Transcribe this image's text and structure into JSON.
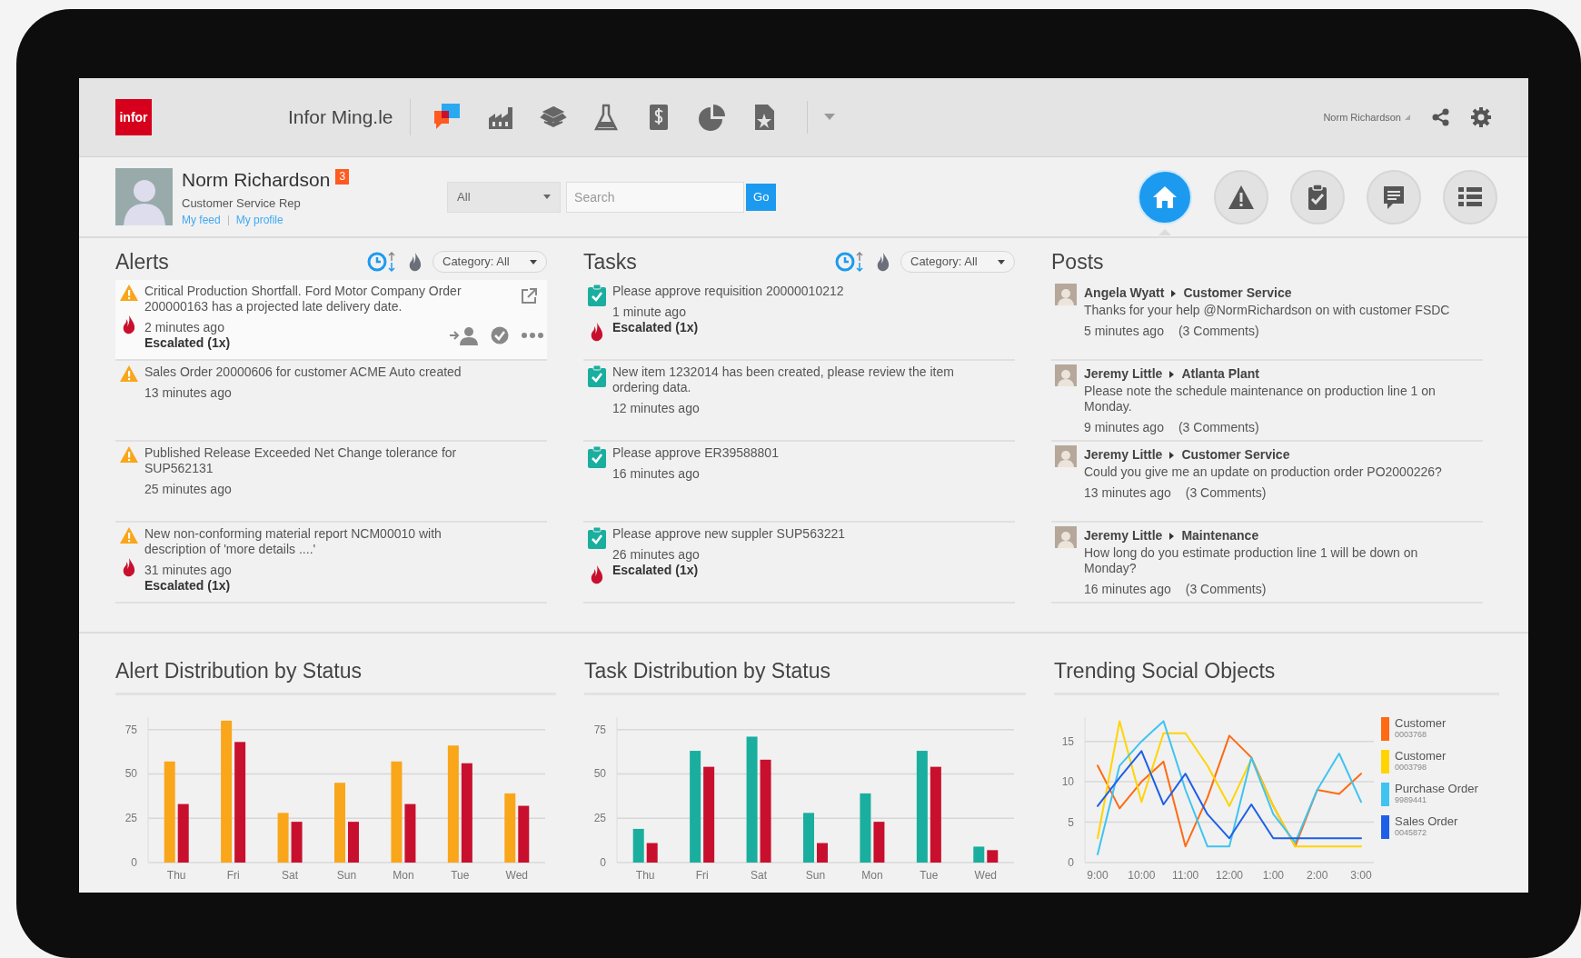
{
  "header": {
    "logo": "infor",
    "app_title": "Infor Ming.le",
    "user_menu": "Norm Richardson"
  },
  "profile": {
    "name": "Norm Richardson",
    "badge": "3",
    "role": "Customer Service Rep",
    "links": [
      "My feed",
      "My profile"
    ]
  },
  "search": {
    "scope": "All",
    "placeholder": "Search",
    "button": "Go"
  },
  "nav_buttons": [
    {
      "kind": "home",
      "selected": true
    },
    {
      "kind": "alerts",
      "selected": false
    },
    {
      "kind": "tasks",
      "selected": false
    },
    {
      "kind": "posts",
      "selected": false
    },
    {
      "kind": "list",
      "selected": false
    }
  ],
  "alerts": {
    "title": "Alerts",
    "filter": "Category: All",
    "items": [
      {
        "text": "Critical Production Shortfall. Ford Motor Company Order 200000163 has a projected late delivery date.",
        "time": "2 minutes ago",
        "escalation": "Escalated (1x)",
        "selected": true
      },
      {
        "text": "Sales Order 20000606 for customer ACME Auto created",
        "time": "13 minutes ago",
        "selected": false
      },
      {
        "text": "Published Release Exceeded Net Change tolerance for SUP562131",
        "time": "25 minutes ago",
        "selected": false
      },
      {
        "text": "New non-conforming material report NCM00010 with description of 'more details ....'",
        "time": "31 minutes ago",
        "escalation": "Escalated (1x)",
        "selected": false
      }
    ]
  },
  "tasks": {
    "title": "Tasks",
    "filter": "Category: All",
    "items": [
      {
        "text": "Please approve requisition 20000010212",
        "time": "1 minute ago",
        "escalation": "Escalated (1x)"
      },
      {
        "text": "New item 1232014 has been created, please review the item ordering data.",
        "time": "12 minutes ago"
      },
      {
        "text": "Please approve ER39588801",
        "time": "16 minutes ago"
      },
      {
        "text": "Please approve new suppler SUP563221",
        "time": "26 minutes ago",
        "escalation": "Escalated (1x)"
      }
    ]
  },
  "posts": {
    "title": "Posts",
    "items": [
      {
        "author": "Angela Wyatt",
        "target": "Customer Service",
        "text": "Thanks for your help @NormRichardson on with customer FSDC",
        "time": "5 minutes ago",
        "comments": "(3 Comments)"
      },
      {
        "author": "Jeremy Little",
        "target": "Atlanta Plant",
        "text": "Please note the schedule maintenance on production line 1 on Monday.",
        "time": "9 minutes ago",
        "comments": "(3 Comments)"
      },
      {
        "author": "Jeremy Little",
        "target": "Customer Service",
        "text": "Could you give me an update on production order PO2000226?",
        "time": "13 minutes ago",
        "comments": "(3 Comments)"
      },
      {
        "author": "Jeremy Little",
        "target": "Maintenance",
        "text": "How long do you estimate production line 1 will be down on Monday?",
        "time": "16 minutes ago",
        "comments": "(3 Comments)"
      }
    ]
  },
  "charts": [
    {
      "title": "Alert Distribution by Status",
      "chart_data": {
        "type": "bar",
        "categories": [
          "Thu",
          "Fri",
          "Sat",
          "Sun",
          "Mon",
          "Tue",
          "Wed"
        ],
        "grid": true,
        "ylim": [
          0,
          82
        ],
        "yticks": [
          0,
          25,
          50,
          75
        ],
        "series": [
          {
            "color": "#f9a61a",
            "values": [
              57,
              80,
              28,
              45,
              57,
              66,
              39
            ]
          },
          {
            "color": "#c8102e",
            "values": [
              33,
              68,
              23,
              23,
              33,
              56,
              32
            ]
          }
        ]
      }
    },
    {
      "title": "Task Distribution by Status",
      "chart_data": {
        "type": "bar",
        "categories": [
          "Thu",
          "Fri",
          "Sat",
          "Sun",
          "Mon",
          "Tue",
          "Wed"
        ],
        "grid": true,
        "ylim": [
          0,
          82
        ],
        "yticks": [
          0,
          25,
          50,
          75
        ],
        "series": [
          {
            "color": "#1aae9f",
            "values": [
              19,
              63,
              71,
              28,
              39,
              63,
              9
            ]
          },
          {
            "color": "#c8102e",
            "values": [
              11,
              54,
              58,
              11,
              23,
              54,
              7
            ]
          }
        ]
      }
    },
    {
      "title": "Trending Social Objects",
      "legend_codes": [
        "0003768",
        "0003798",
        "9989441",
        "0045872"
      ],
      "chart_data": {
        "type": "line",
        "categories": [
          "9:00",
          null,
          "10:00",
          null,
          "11:00",
          null,
          "12:00",
          null,
          "1:00",
          null,
          "2:00",
          null,
          "3:00"
        ],
        "grid": true,
        "ylim": [
          0,
          18
        ],
        "yticks": [
          0,
          5,
          10,
          15
        ],
        "series": [
          {
            "name": "Customer",
            "color": "#ff6a13",
            "values": [
              12,
              6.7,
              10,
              12.5,
              2,
              8,
              15.7,
              13,
              7,
              2,
              9,
              8.5,
              11
            ]
          },
          {
            "name": "Customer",
            "color": "#ffd400",
            "values": [
              3,
              17.5,
              7.5,
              16,
              16,
              12,
              7,
              12.8,
              7,
              2,
              2,
              2,
              2
            ]
          },
          {
            "name": "Purchase Order",
            "color": "#3fc4f0",
            "values": [
              1,
              12,
              15,
              17.5,
              9,
              2,
              2,
              13,
              6,
              2.5,
              9,
              13.5,
              7.5
            ]
          },
          {
            "name": "Sales Order",
            "color": "#1e5fe8",
            "values": [
              7,
              10.5,
              13.8,
              7.2,
              11,
              6,
              3,
              7.2,
              3,
              3,
              3,
              3,
              3
            ]
          }
        ]
      }
    }
  ]
}
